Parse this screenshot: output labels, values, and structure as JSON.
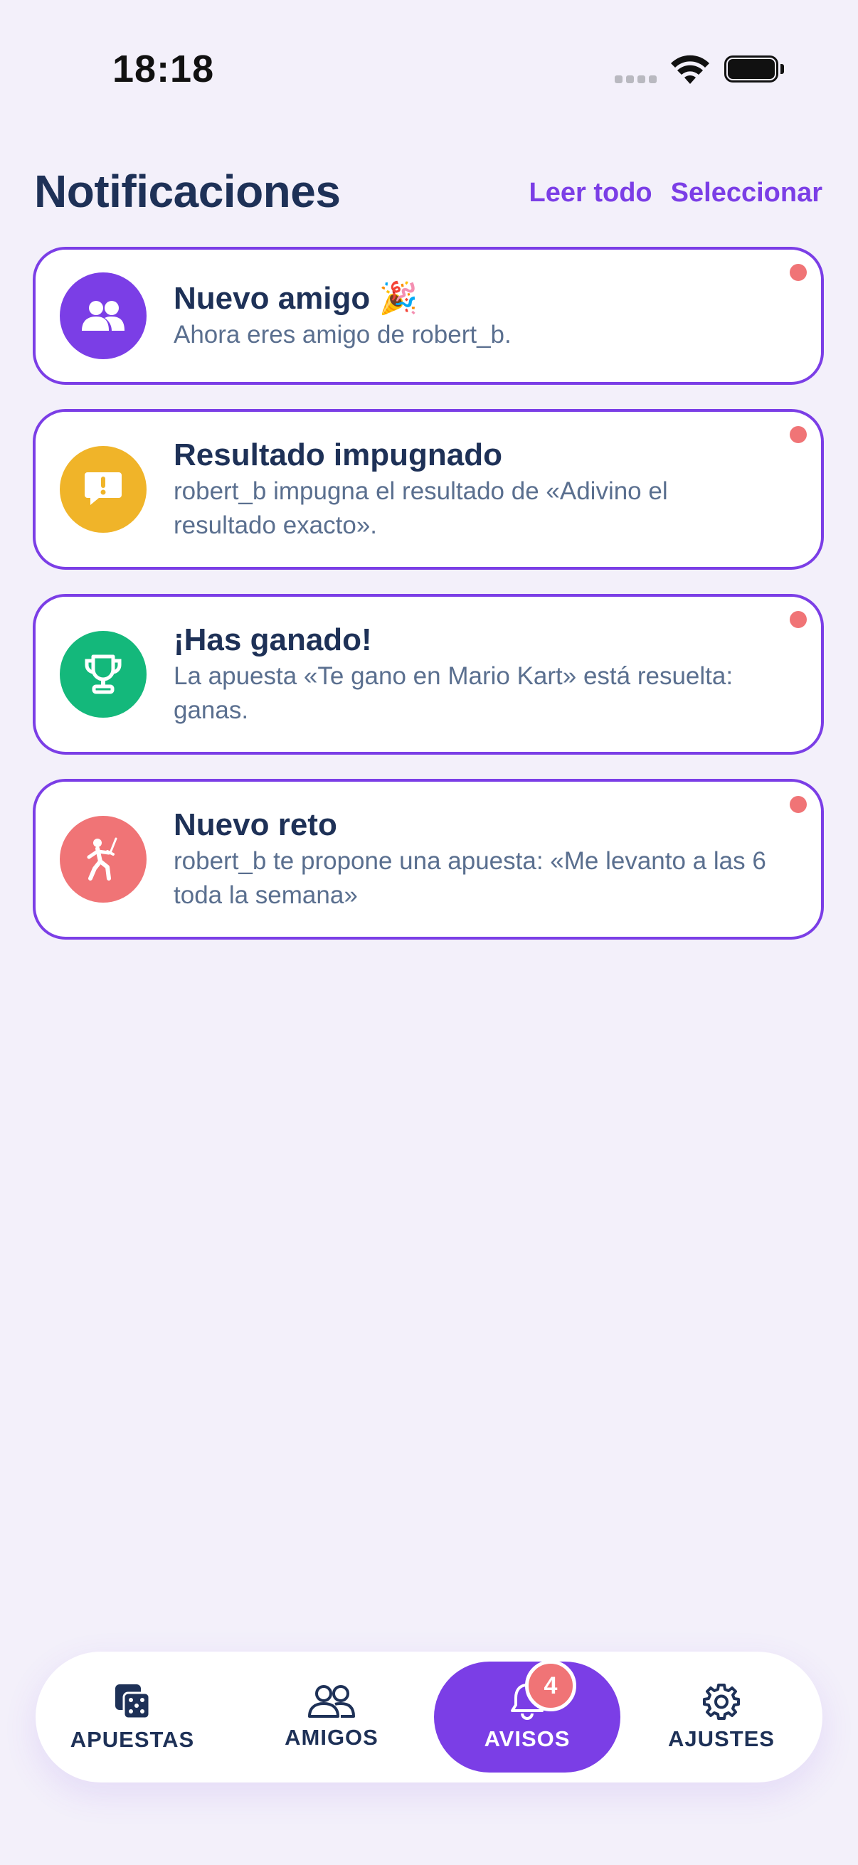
{
  "status_bar": {
    "time": "18:18"
  },
  "header": {
    "title": "Notificaciones",
    "read_all_label": "Leer todo",
    "select_label": "Seleccionar"
  },
  "notifications": [
    {
      "icon": "friends-icon",
      "color": "#7b3ee6",
      "title": "Nuevo amigo",
      "emoji": "🎉",
      "body": "Ahora eres amigo de robert_b.",
      "unread": true
    },
    {
      "icon": "alert-message-icon",
      "color": "#f0b429",
      "title": "Resultado impugnado",
      "body": "robert_b impugna el resultado de «Adivino el resultado exacto».",
      "unread": true
    },
    {
      "icon": "trophy-icon",
      "color": "#14b87b",
      "title": "¡Has ganado!",
      "body": "La apuesta «Te gano en Mario Kart» está resuelta: ganas.",
      "unread": true
    },
    {
      "icon": "fencing-icon",
      "color": "#f07476",
      "title": "Nuevo reto",
      "body": "robert_b te propone una apuesta: «Me levanto a las 6 toda la semana»",
      "unread": true
    }
  ],
  "tabbar": {
    "tabs": [
      {
        "label": "APUESTAS",
        "icon": "dice-icon"
      },
      {
        "label": "AMIGOS",
        "icon": "friends-outline-icon"
      },
      {
        "label": "AVISOS",
        "icon": "bell-icon",
        "active": true,
        "badge": "4"
      },
      {
        "label": "AJUSTES",
        "icon": "gear-icon"
      }
    ]
  },
  "colors": {
    "accent": "#7b3ee6",
    "unread_dot": "#f07476",
    "text_primary": "#1e3157",
    "text_secondary": "#5a6f8f"
  }
}
